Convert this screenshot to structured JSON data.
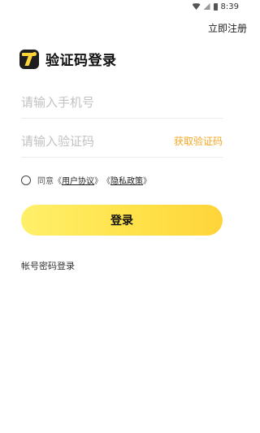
{
  "status_bar": {
    "time": "8:39",
    "icons": [
      "wifi-icon",
      "signal-icon",
      "battery-icon"
    ]
  },
  "header": {
    "register_link": "立即注册"
  },
  "title": {
    "logo_icon": "app-logo-icon",
    "text": "验证码登录"
  },
  "form": {
    "phone_placeholder": "请输入手机号",
    "phone_value": "",
    "code_placeholder": "请输入验证码",
    "code_value": "",
    "get_code_label": "获取验证码"
  },
  "agreement": {
    "prefix": "同意",
    "open_quote_1": "《",
    "user_agreement": "用户协议",
    "close_quote_1": "》",
    "open_quote_2": "《",
    "privacy_policy": "隐私政策",
    "close_quote_2": "》",
    "checked": false
  },
  "login_button": "登录",
  "password_login_link": "帐号密码登录",
  "colors": {
    "accent_yellow": "#ffd43a",
    "link_orange": "#f5a623"
  }
}
